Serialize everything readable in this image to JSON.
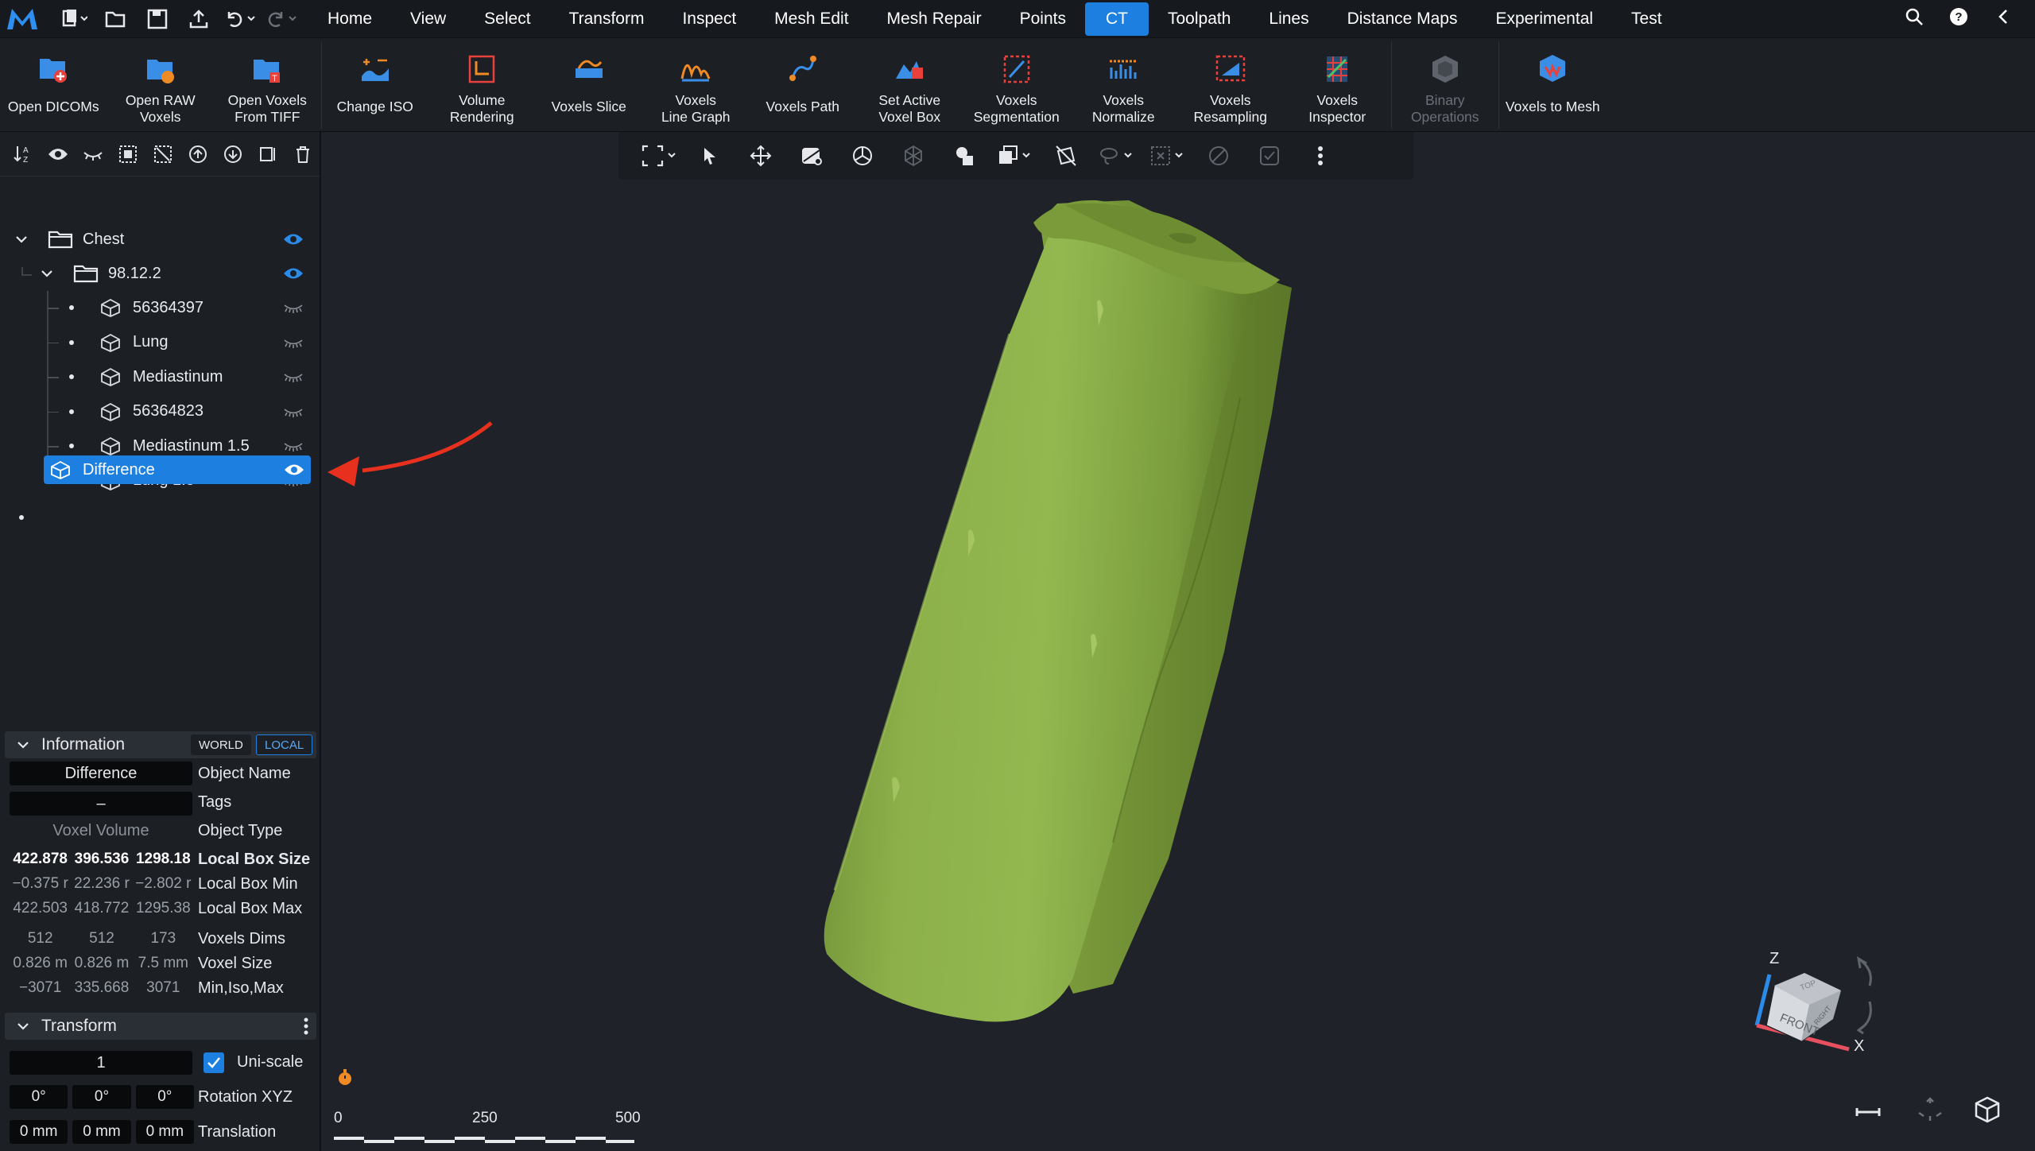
{
  "menubar": {
    "menus": [
      {
        "label": "Home",
        "active": false
      },
      {
        "label": "View",
        "active": false
      },
      {
        "label": "Select",
        "active": false
      },
      {
        "label": "Transform",
        "active": false
      },
      {
        "label": "Inspect",
        "active": false
      },
      {
        "label": "Mesh Edit",
        "active": false
      },
      {
        "label": "Mesh Repair",
        "active": false
      },
      {
        "label": "Points",
        "active": false
      },
      {
        "label": "CT",
        "active": true
      },
      {
        "label": "Toolpath",
        "active": false
      },
      {
        "label": "Lines",
        "active": false
      },
      {
        "label": "Distance Maps",
        "active": false
      },
      {
        "label": "Experimental",
        "active": false
      },
      {
        "label": "Test",
        "active": false
      }
    ],
    "accent_color": "#1d80e0"
  },
  "ribbon": {
    "buttons": [
      {
        "label1": "",
        "label2": "Open DICOMs",
        "icon": "open-dicoms-icon"
      },
      {
        "label1": "Open RAW",
        "label2": "Voxels",
        "icon": "open-raw-voxels-icon"
      },
      {
        "label1": "Open Voxels",
        "label2": "From TIFF",
        "icon": "open-tiff-icon"
      },
      {
        "label1": "",
        "label2": "Change ISO",
        "icon": "change-iso-icon"
      },
      {
        "label1": "Volume",
        "label2": "Rendering",
        "icon": "volume-rendering-icon"
      },
      {
        "label1": "",
        "label2": "Voxels Slice",
        "icon": "voxels-slice-icon"
      },
      {
        "label1": "Voxels",
        "label2": "Line Graph",
        "icon": "line-graph-icon"
      },
      {
        "label1": "",
        "label2": "Voxels Path",
        "icon": "voxels-path-icon"
      },
      {
        "label1": "Set Active",
        "label2": "Voxel Box",
        "icon": "voxel-box-icon"
      },
      {
        "label1": "Voxels",
        "label2": "Segmentation",
        "icon": "segmentation-icon"
      },
      {
        "label1": "Voxels",
        "label2": "Normalize",
        "icon": "normalize-icon"
      },
      {
        "label1": "Voxels",
        "label2": "Resampling",
        "icon": "resampling-icon"
      },
      {
        "label1": "Voxels",
        "label2": "Inspector",
        "icon": "inspector-icon"
      },
      {
        "label1": "Binary",
        "label2": "Operations",
        "icon": "binary-operations-icon"
      },
      {
        "label1": "",
        "label2": "Voxels to Mesh",
        "icon": "voxels-to-mesh-icon"
      }
    ]
  },
  "tree": {
    "root": {
      "label": "Chest"
    },
    "group": {
      "label": "98.12.2"
    },
    "children": [
      {
        "label": "56364397"
      },
      {
        "label": "Lung"
      },
      {
        "label": "Mediastinum"
      },
      {
        "label": "56364823"
      },
      {
        "label": "Mediastinum 1.5"
      },
      {
        "label": "Lung 1.5"
      }
    ],
    "selected": {
      "label": "Difference"
    }
  },
  "information": {
    "title": "Information",
    "world_label": "WORLD",
    "local_label": "LOCAL",
    "object_name_value": "Difference",
    "object_name_label": "Object Name",
    "tags_value": "–",
    "tags_label": "Tags",
    "object_type_value": "Voxel Volume",
    "object_type_label": "Object Type",
    "box_size": [
      "422.878",
      "396.536",
      "1298.18"
    ],
    "box_size_label": "Local Box Size",
    "box_min": [
      "−0.375 r",
      "22.236 r",
      "−2.802 r"
    ],
    "box_min_label": "Local Box Min",
    "box_max": [
      "422.503",
      "418.772",
      "1295.38"
    ],
    "box_max_label": "Local Box Max",
    "dims": [
      "512",
      "512",
      "173"
    ],
    "dims_label": "Voxels Dims",
    "voxel_size": [
      "0.826 m",
      "0.826 m",
      "7.5 mm"
    ],
    "voxel_size_label": "Voxel Size",
    "min_iso_max": [
      "−3071",
      "335.668",
      "3071"
    ],
    "min_iso_max_label": "Min,Iso,Max"
  },
  "transform": {
    "title": "Transform",
    "scale_value": "1",
    "uniscale_label": "Uni-scale",
    "uniscale_checked": true,
    "rotation": [
      "0°",
      "0°",
      "0°"
    ],
    "rotation_label": "Rotation XYZ",
    "translation": [
      "0 mm",
      "0 mm",
      "0 mm"
    ],
    "translation_label": "Translation"
  },
  "viewport": {
    "scale_labels": [
      "0",
      "250",
      "500"
    ],
    "axes": {
      "z": "Z",
      "x": "X"
    },
    "cube_faces": {
      "front": "FRONT",
      "top": "TOP",
      "right": "RIGHT"
    },
    "model_color": "#86a840"
  }
}
